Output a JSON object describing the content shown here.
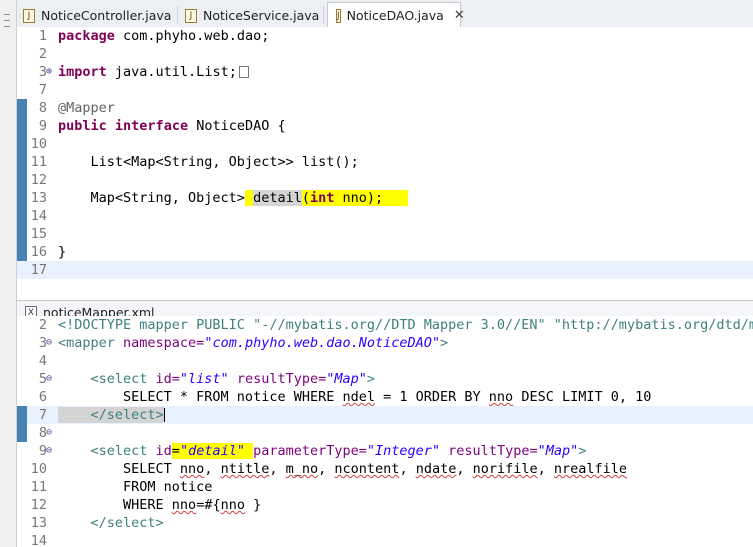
{
  "tabs": [
    {
      "label": "NoticeController.java",
      "icon": "java-file-icon",
      "active": false
    },
    {
      "label": "NoticeService.java",
      "icon": "java-file-icon",
      "active": false
    },
    {
      "label": "NoticeDAO.java",
      "icon": "java-file-icon",
      "active": true,
      "close": "✕"
    }
  ],
  "java_editor": {
    "line_numbers": [
      "1",
      "2",
      "3",
      "7",
      "8",
      "9",
      "10",
      "11",
      "12",
      "13",
      "14",
      "15",
      "16",
      "17"
    ],
    "fold_markers": {
      "3": "⊕"
    },
    "lines": {
      "l1_kw": "package",
      "l1_rest": " com.phyho.web.dao;",
      "l3_kw": "import",
      "l3_rest": " java.util.List;",
      "l8": "@Mapper",
      "l9_kw1": "public",
      "l9_kw2": "interface",
      "l9_rest": " NoticeDAO {",
      "l11": "    List<Map<String, Object>> list();",
      "l13_a": "    Map<String, Object>",
      "l13_b": " ",
      "l13_c": "detail",
      "l13_d": "(",
      "l13_e": "int",
      "l13_f": " nno);   ",
      "l16": "}"
    }
  },
  "xml_tab": {
    "label": "noticeMapper.xml",
    "icon": "xml-file-icon"
  },
  "xml_editor": {
    "line_numbers": [
      "2",
      "3",
      "4",
      "5",
      "6",
      "7",
      "8",
      "9",
      "10",
      "11",
      "12",
      "13",
      "14"
    ],
    "fold_markers": {
      "3": "⊖",
      "5": "⊖",
      "8": "⊖",
      "9": "⊖"
    },
    "lines": {
      "l2": "<!DOCTYPE mapper PUBLIC \"-//mybatis.org//DTD Mapper 3.0//EN\" \"http://mybatis.org/dtd/my",
      "l3_tag": "<mapper",
      "l3_attr": " namespace=",
      "l3_val": "\"com.phyho.web.dao.NoticeDAO\"",
      "l3_end": ">",
      "l5_tag": "    <select",
      "l5_attr1": " id=",
      "l5_val1": "\"list\"",
      "l5_attr2": " resultType=",
      "l5_val2": "\"Map\"",
      "l5_end": ">",
      "l6_a": "        SELECT * FROM notice WHERE ",
      "l6_b": "ndel",
      "l6_c": " = 1 ORDER BY ",
      "l6_d": "nno",
      "l6_e": " DESC LIMIT 0, 10",
      "l7": "    </select>",
      "l9_tag": "    <select",
      "l9_attr1": " id",
      "l9_eq": "=",
      "l9_val1": "\"detail\" ",
      "l9_attr2": "parameterType=",
      "l9_val2": "\"Integer\"",
      "l9_attr3": " resultType=",
      "l9_val3": "\"Map\"",
      "l9_end": ">",
      "l10_a": "        SELECT ",
      "l10_b": "nno",
      "l10_c": ", ",
      "l10_d": "ntitle",
      "l10_e": ", ",
      "l10_f": "m_no",
      "l10_g": ", ",
      "l10_h": "ncontent",
      "l10_i": ", ",
      "l10_j": "ndate",
      "l10_k": ", ",
      "l10_l": "norifile",
      "l10_m": ", ",
      "l10_n": "nrealfile",
      "l11": "        FROM notice",
      "l12_a": "        WHERE ",
      "l12_b": "nno",
      "l12_c": "=#{",
      "l12_d": "nno",
      "l12_e": " }",
      "l13": "    </select>"
    }
  },
  "colors": {
    "keyword": "#7f0055",
    "tag": "#3f7f7f",
    "attr": "#7f007f",
    "string": "#2a00ff",
    "highlight": "#ffff00",
    "current_line": "#e8f2fe"
  }
}
